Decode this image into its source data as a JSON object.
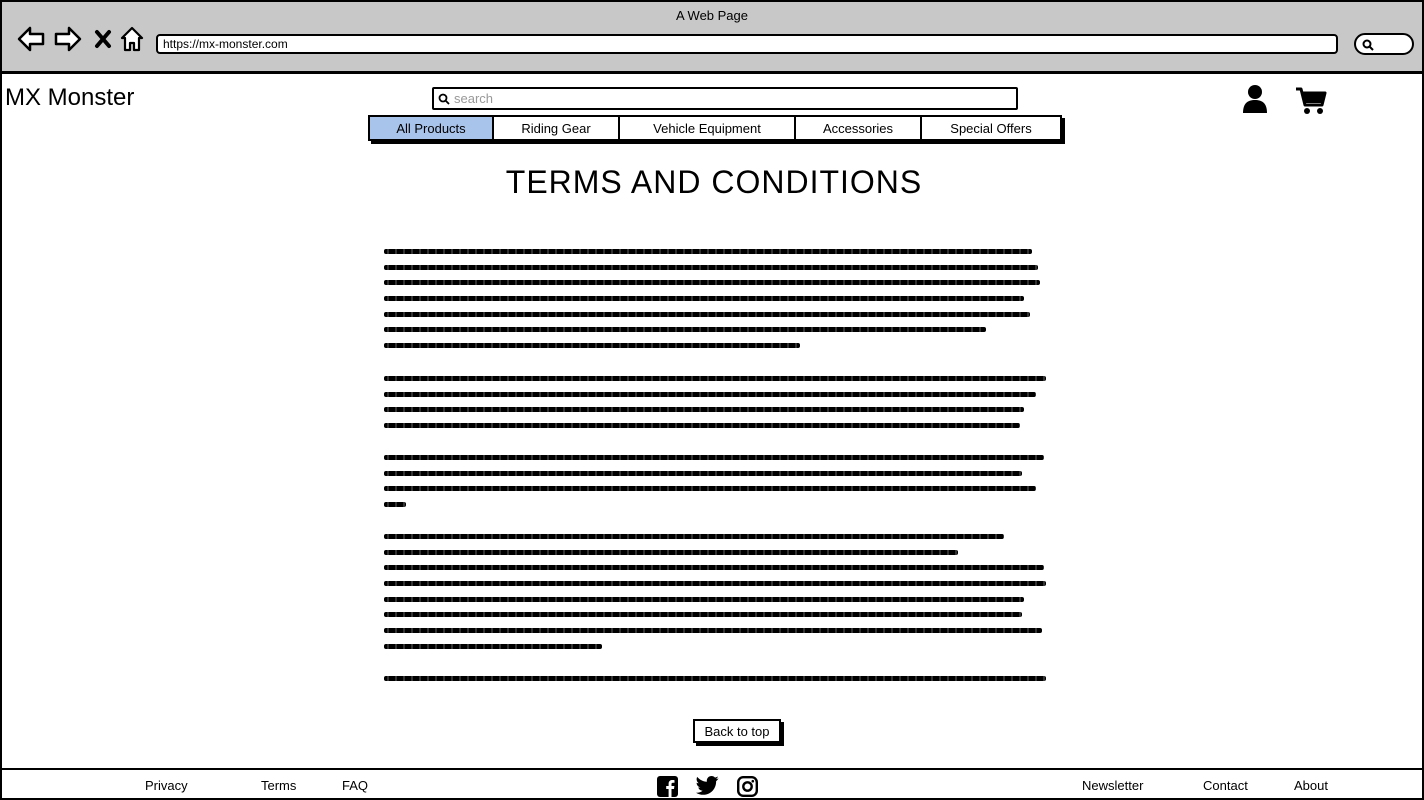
{
  "browser": {
    "title": "A Web Page",
    "url": "https://mx-monster.com"
  },
  "site": {
    "logo": "MX Monster",
    "search_placeholder": "search"
  },
  "nav_tabs": [
    {
      "label": "All Products",
      "active": true
    },
    {
      "label": "Riding Gear",
      "active": false
    },
    {
      "label": "Vehicle Equipment",
      "active": false
    },
    {
      "label": "Accessories",
      "active": false
    },
    {
      "label": "Special Offers",
      "active": false
    }
  ],
  "content": {
    "heading": "TERMS AND CONDITIONS",
    "back_to_top": "Back to top"
  },
  "footer": {
    "privacy": "Privacy",
    "terms": "Terms",
    "faq": "FAQ",
    "newsletter": "Newsletter",
    "contact": "Contact",
    "about": "About"
  },
  "colors": {
    "chrome": "#c8c8c8",
    "active_tab": "#a9c4eb"
  }
}
